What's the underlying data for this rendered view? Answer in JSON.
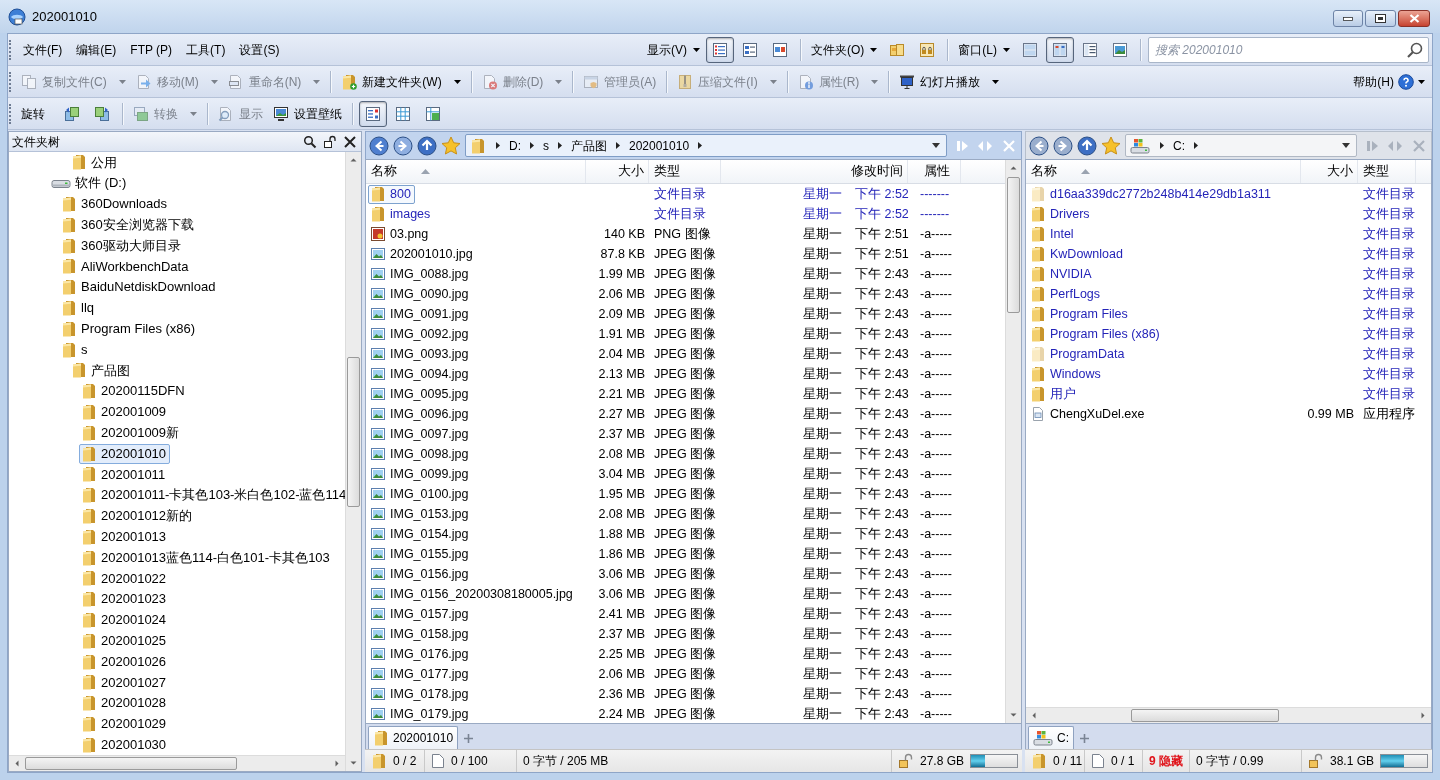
{
  "window": {
    "title": "202001010"
  },
  "menu_bar": {
    "menus": [
      "文件(F)",
      "编辑(E)",
      "FTP (P)",
      "工具(T)",
      "设置(S)"
    ],
    "view_menu": "显示(V)",
    "view_buttons": [
      {
        "selected": true
      },
      {
        "selected": false
      },
      {
        "selected": false
      }
    ],
    "folder_menu": "文件夹(O)",
    "window_menu": "窗口(L)",
    "layout_buttons": [
      {
        "selected": false
      },
      {
        "selected": true
      },
      {
        "selected": false
      },
      {
        "selected": false
      }
    ],
    "search": {
      "placeholder": "搜索 202001010"
    }
  },
  "file_toolbar": {
    "buttons": [
      {
        "label": "复制文件(C)",
        "disabled": true,
        "dropdown": true
      },
      {
        "label": "移动(M)",
        "disabled": true,
        "dropdown": true
      },
      {
        "label": "重命名(N)",
        "disabled": true,
        "dropdown": true
      },
      {
        "label": "新建文件夹(W)",
        "disabled": false,
        "dropdown": true
      },
      {
        "label": "删除(D)",
        "disabled": true,
        "dropdown": true
      },
      {
        "label": "管理员(A)",
        "disabled": true,
        "dropdown": false
      },
      {
        "label": "压缩文件(I)",
        "disabled": true,
        "dropdown": true
      },
      {
        "label": "属性(R)",
        "disabled": true,
        "dropdown": true
      },
      {
        "label": "幻灯片播放",
        "disabled": false,
        "dropdown": true
      }
    ],
    "help": "帮助(H)"
  },
  "image_toolbar": {
    "label": "旋转",
    "buttons": [
      {
        "label": "转换",
        "disabled": true,
        "dropdown": true
      },
      {
        "label": "显示",
        "disabled": true,
        "dropdown": false
      },
      {
        "label": "设置壁纸",
        "disabled": false,
        "dropdown": false
      }
    ],
    "sort_buttons": [
      {
        "selected": true
      },
      {
        "selected": false
      },
      {
        "selected": false
      }
    ]
  },
  "folder_tree": {
    "title": "文件夹树",
    "items": [
      {
        "children": [
          {
            "children": [
              {
                "label": "公用",
                "kind": "folder",
                "selected": false
              }
            ]
          }
        ]
      },
      {
        "label": "软件 (D:)",
        "kind": "drive",
        "selected": false,
        "children": [
          {
            "label": "360Downloads",
            "kind": "folder",
            "selected": false
          },
          {
            "label": "360安全浏览器下载",
            "kind": "folder",
            "selected": false
          },
          {
            "label": "360驱动大师目录",
            "kind": "folder",
            "selected": false
          },
          {
            "label": "AliWorkbenchData",
            "kind": "folder",
            "selected": false
          },
          {
            "label": "BaiduNetdiskDownload",
            "kind": "folder",
            "selected": false
          },
          {
            "label": "llq",
            "kind": "folder",
            "selected": false
          },
          {
            "label": "Program Files (x86)",
            "kind": "folder",
            "selected": false
          },
          {
            "label": "s",
            "kind": "folder",
            "selected": false,
            "children": [
              {
                "label": "产品图",
                "kind": "folder",
                "selected": false,
                "children": [
                  {
                    "label": "20200115DFN",
                    "kind": "folder",
                    "selected": false
                  },
                  {
                    "label": "202001009",
                    "kind": "folder",
                    "selected": false
                  },
                  {
                    "label": "202001009新",
                    "kind": "folder",
                    "selected": false
                  },
                  {
                    "label": "202001010",
                    "kind": "folder",
                    "selected": true
                  },
                  {
                    "label": "202001011",
                    "kind": "folder",
                    "selected": false
                  },
                  {
                    "label": "202001011-卡其色103-米白色102-蓝色114",
                    "kind": "folder",
                    "selected": false
                  },
                  {
                    "label": "202001012新的",
                    "kind": "folder",
                    "selected": false
                  },
                  {
                    "label": "202001013",
                    "kind": "folder",
                    "selected": false
                  },
                  {
                    "label": "202001013蓝色114-白色101-卡其色103",
                    "kind": "folder",
                    "selected": false
                  },
                  {
                    "label": "202001022",
                    "kind": "folder",
                    "selected": false
                  },
                  {
                    "label": "202001023",
                    "kind": "folder",
                    "selected": false
                  },
                  {
                    "label": "202001024",
                    "kind": "folder",
                    "selected": false
                  },
                  {
                    "label": "202001025",
                    "kind": "folder",
                    "selected": false
                  },
                  {
                    "label": "202001026",
                    "kind": "folder",
                    "selected": false
                  },
                  {
                    "label": "202001027",
                    "kind": "folder",
                    "selected": false
                  },
                  {
                    "label": "202001028",
                    "kind": "folder",
                    "selected": false
                  },
                  {
                    "label": "202001029",
                    "kind": "folder",
                    "selected": false
                  },
                  {
                    "label": "202001030",
                    "kind": "folder",
                    "selected": false
                  }
                ]
              }
            ]
          }
        ]
      }
    ]
  },
  "file_panes": [
    {
      "kind": "folder",
      "active": true,
      "path": [
        "D:",
        "s",
        "产品图",
        "202001010"
      ],
      "columns": [
        {
          "label": "名称",
          "kind": "name",
          "sorted": true
        },
        {
          "label": "大小",
          "kind": "size",
          "sorted": false
        },
        {
          "label": "类型",
          "kind": "type",
          "sorted": false
        },
        {
          "label": "修改时间",
          "kind": "modified",
          "sorted": false
        },
        {
          "label": "属性",
          "kind": "attributes",
          "sorted": false
        }
      ],
      "rows": [
        {
          "name": "800",
          "kind": "folder",
          "selected": true,
          "type": "文件目录",
          "weekday": "星期一",
          "time": "下午 2:52",
          "attributes": "-------"
        },
        {
          "name": "images",
          "kind": "folder",
          "selected": false,
          "type": "文件目录",
          "weekday": "星期一",
          "time": "下午 2:52",
          "attributes": "-------"
        },
        {
          "name": "03.png",
          "kind": "png",
          "selected": false,
          "size": "140 KB",
          "type": "PNG 图像",
          "weekday": "星期一",
          "time": "下午 2:51",
          "attributes": "-a-----"
        },
        {
          "name": "202001010.jpg",
          "kind": "jpg",
          "selected": false,
          "size": "87.8 KB",
          "type": "JPEG 图像",
          "weekday": "星期一",
          "time": "下午 2:51",
          "attributes": "-a-----"
        },
        {
          "name": "IMG_0088.jpg",
          "kind": "jpg",
          "selected": false,
          "size": "1.99 MB",
          "type": "JPEG 图像",
          "weekday": "星期一",
          "time": "下午 2:43",
          "attributes": "-a-----"
        },
        {
          "name": "IMG_0090.jpg",
          "kind": "jpg",
          "selected": false,
          "size": "2.06 MB",
          "type": "JPEG 图像",
          "weekday": "星期一",
          "time": "下午 2:43",
          "attributes": "-a-----"
        },
        {
          "name": "IMG_0091.jpg",
          "kind": "jpg",
          "selected": false,
          "size": "2.09 MB",
          "type": "JPEG 图像",
          "weekday": "星期一",
          "time": "下午 2:43",
          "attributes": "-a-----"
        },
        {
          "name": "IMG_0092.jpg",
          "kind": "jpg",
          "selected": false,
          "size": "1.91 MB",
          "type": "JPEG 图像",
          "weekday": "星期一",
          "time": "下午 2:43",
          "attributes": "-a-----"
        },
        {
          "name": "IMG_0093.jpg",
          "kind": "jpg",
          "selected": false,
          "size": "2.04 MB",
          "type": "JPEG 图像",
          "weekday": "星期一",
          "time": "下午 2:43",
          "attributes": "-a-----"
        },
        {
          "name": "IMG_0094.jpg",
          "kind": "jpg",
          "selected": false,
          "size": "2.13 MB",
          "type": "JPEG 图像",
          "weekday": "星期一",
          "time": "下午 2:43",
          "attributes": "-a-----"
        },
        {
          "name": "IMG_0095.jpg",
          "kind": "jpg",
          "selected": false,
          "size": "2.21 MB",
          "type": "JPEG 图像",
          "weekday": "星期一",
          "time": "下午 2:43",
          "attributes": "-a-----"
        },
        {
          "name": "IMG_0096.jpg",
          "kind": "jpg",
          "selected": false,
          "size": "2.27 MB",
          "type": "JPEG 图像",
          "weekday": "星期一",
          "time": "下午 2:43",
          "attributes": "-a-----"
        },
        {
          "name": "IMG_0097.jpg",
          "kind": "jpg",
          "selected": false,
          "size": "2.37 MB",
          "type": "JPEG 图像",
          "weekday": "星期一",
          "time": "下午 2:43",
          "attributes": "-a-----"
        },
        {
          "name": "IMG_0098.jpg",
          "kind": "jpg",
          "selected": false,
          "size": "2.08 MB",
          "type": "JPEG 图像",
          "weekday": "星期一",
          "time": "下午 2:43",
          "attributes": "-a-----"
        },
        {
          "name": "IMG_0099.jpg",
          "kind": "jpg",
          "selected": false,
          "size": "3.04 MB",
          "type": "JPEG 图像",
          "weekday": "星期一",
          "time": "下午 2:43",
          "attributes": "-a-----"
        },
        {
          "name": "IMG_0100.jpg",
          "kind": "jpg",
          "selected": false,
          "size": "1.95 MB",
          "type": "JPEG 图像",
          "weekday": "星期一",
          "time": "下午 2:43",
          "attributes": "-a-----"
        },
        {
          "name": "IMG_0153.jpg",
          "kind": "jpg",
          "selected": false,
          "size": "2.08 MB",
          "type": "JPEG 图像",
          "weekday": "星期一",
          "time": "下午 2:43",
          "attributes": "-a-----"
        },
        {
          "name": "IMG_0154.jpg",
          "kind": "jpg",
          "selected": false,
          "size": "1.88 MB",
          "type": "JPEG 图像",
          "weekday": "星期一",
          "time": "下午 2:43",
          "attributes": "-a-----"
        },
        {
          "name": "IMG_0155.jpg",
          "kind": "jpg",
          "selected": false,
          "size": "1.86 MB",
          "type": "JPEG 图像",
          "weekday": "星期一",
          "time": "下午 2:43",
          "attributes": "-a-----"
        },
        {
          "name": "IMG_0156.jpg",
          "kind": "jpg",
          "selected": false,
          "size": "3.06 MB",
          "type": "JPEG 图像",
          "weekday": "星期一",
          "time": "下午 2:43",
          "attributes": "-a-----"
        },
        {
          "name": "IMG_0156_20200308180005.jpg",
          "kind": "jpg",
          "selected": false,
          "size": "3.06 MB",
          "type": "JPEG 图像",
          "weekday": "星期一",
          "time": "下午 2:43",
          "attributes": "-a-----"
        },
        {
          "name": "IMG_0157.jpg",
          "kind": "jpg",
          "selected": false,
          "size": "2.41 MB",
          "type": "JPEG 图像",
          "weekday": "星期一",
          "time": "下午 2:43",
          "attributes": "-a-----"
        },
        {
          "name": "IMG_0158.jpg",
          "kind": "jpg",
          "selected": false,
          "size": "2.37 MB",
          "type": "JPEG 图像",
          "weekday": "星期一",
          "time": "下午 2:43",
          "attributes": "-a-----"
        },
        {
          "name": "IMG_0176.jpg",
          "kind": "jpg",
          "selected": false,
          "size": "2.25 MB",
          "type": "JPEG 图像",
          "weekday": "星期一",
          "time": "下午 2:43",
          "attributes": "-a-----"
        },
        {
          "name": "IMG_0177.jpg",
          "kind": "jpg",
          "selected": false,
          "size": "2.06 MB",
          "type": "JPEG 图像",
          "weekday": "星期一",
          "time": "下午 2:43",
          "attributes": "-a-----"
        },
        {
          "name": "IMG_0178.jpg",
          "kind": "jpg",
          "selected": false,
          "size": "2.36 MB",
          "type": "JPEG 图像",
          "weekday": "星期一",
          "time": "下午 2:43",
          "attributes": "-a-----"
        },
        {
          "name": "IMG_0179.jpg",
          "kind": "jpg",
          "selected": false,
          "size": "2.24 MB",
          "type": "JPEG 图像",
          "weekday": "星期一",
          "time": "下午 2:43",
          "attributes": "-a-----"
        }
      ],
      "tabs": [
        {
          "label": "202001010",
          "selected": true
        }
      ],
      "status": {
        "folders": "0 / 2",
        "files": "0 / 100",
        "bytes": "0 字节 / 205 MB",
        "free": "27.8 GB",
        "level": 0.3
      }
    },
    {
      "kind": "drive",
      "active": false,
      "path": [
        "C:"
      ],
      "columns": [
        {
          "label": "名称",
          "kind": "name",
          "sorted": true
        },
        {
          "label": "大小",
          "kind": "size",
          "sorted": false
        },
        {
          "label": "类型",
          "kind": "type",
          "sorted": false
        }
      ],
      "rows": [
        {
          "name": "d16aa339dc2772b248b414e29db1a311",
          "kind": "folder",
          "hidden": true,
          "selected": false,
          "type": "文件目录"
        },
        {
          "name": "Drivers",
          "kind": "folder",
          "hidden": false,
          "selected": false,
          "type": "文件目录"
        },
        {
          "name": "Intel",
          "kind": "folder",
          "hidden": false,
          "selected": false,
          "type": "文件目录"
        },
        {
          "name": "KwDownload",
          "kind": "folder",
          "hidden": false,
          "selected": false,
          "type": "文件目录"
        },
        {
          "name": "NVIDIA",
          "kind": "folder",
          "hidden": false,
          "selected": false,
          "type": "文件目录"
        },
        {
          "name": "PerfLogs",
          "kind": "folder",
          "hidden": false,
          "selected": false,
          "type": "文件目录"
        },
        {
          "name": "Program Files",
          "kind": "folder",
          "hidden": false,
          "selected": false,
          "type": "文件目录"
        },
        {
          "name": "Program Files (x86)",
          "kind": "folder",
          "hidden": false,
          "selected": false,
          "type": "文件目录"
        },
        {
          "name": "ProgramData",
          "kind": "folder",
          "hidden": true,
          "selected": false,
          "type": "文件目录"
        },
        {
          "name": "Windows",
          "kind": "folder",
          "hidden": false,
          "selected": false,
          "type": "文件目录"
        },
        {
          "name": "用户",
          "kind": "folder",
          "hidden": false,
          "selected": false,
          "type": "文件目录"
        },
        {
          "name": "ChengXuDel.exe",
          "kind": "exe",
          "hidden": false,
          "selected": false,
          "size": "0.99 MB",
          "type": "应用程序"
        }
      ],
      "tabs": [
        {
          "label": "C:",
          "selected": true
        }
      ],
      "status": {
        "folders": "0 / 11",
        "files": "0 / 1",
        "hidden": "9 隐藏",
        "bytes": "0 字节 / 0.99",
        "free": "38.1 GB",
        "level": 0.5
      }
    }
  ]
}
